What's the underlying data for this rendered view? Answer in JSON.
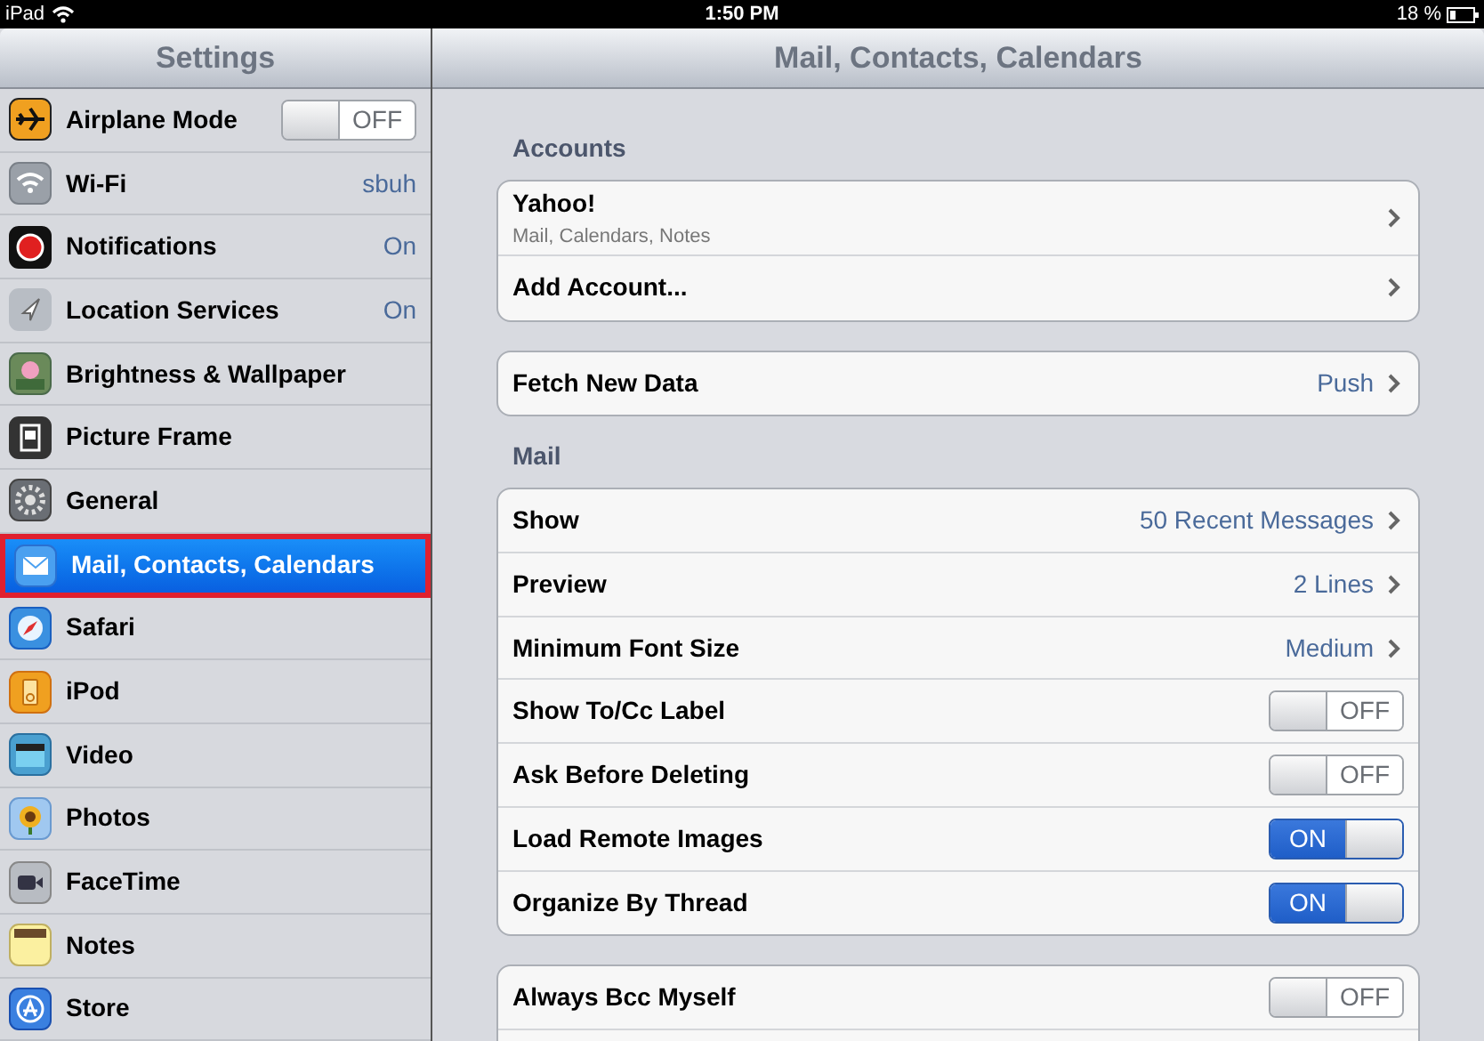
{
  "status_bar": {
    "device": "iPad",
    "time": "1:50 PM",
    "battery": "18 %"
  },
  "sidebar": {
    "title": "Settings",
    "items": [
      {
        "label": "Airplane Mode",
        "kind": "switch",
        "on": false,
        "switch_text": "OFF",
        "selected": false
      },
      {
        "label": "Wi-Fi",
        "kind": "link",
        "value": "sbuh",
        "selected": false
      },
      {
        "label": "Notifications",
        "kind": "link",
        "value": "On",
        "selected": false
      },
      {
        "label": "Location Services",
        "kind": "link",
        "value": "On",
        "selected": false
      },
      {
        "label": "Brightness & Wallpaper",
        "kind": "link",
        "selected": false
      },
      {
        "label": "Picture Frame",
        "kind": "link",
        "selected": false
      },
      {
        "label": "General",
        "kind": "link",
        "selected": false
      },
      {
        "label": "Mail, Contacts, Calendars",
        "kind": "link",
        "selected": true
      },
      {
        "label": "Safari",
        "kind": "link",
        "selected": false
      },
      {
        "label": "iPod",
        "kind": "link",
        "selected": false
      },
      {
        "label": "Video",
        "kind": "link",
        "selected": false
      },
      {
        "label": "Photos",
        "kind": "link",
        "selected": false
      },
      {
        "label": "FaceTime",
        "kind": "link",
        "selected": false
      },
      {
        "label": "Notes",
        "kind": "link",
        "selected": false
      },
      {
        "label": "Store",
        "kind": "link",
        "selected": false
      }
    ]
  },
  "detail": {
    "title": "Mail, Contacts, Calendars",
    "groups": [
      {
        "header": "Accounts",
        "rows": [
          {
            "label": "Yahoo!",
            "kind": "link",
            "subtitle": "Mail, Calendars, Notes"
          },
          {
            "label": "Add Account...",
            "kind": "link"
          }
        ]
      },
      {
        "rows": [
          {
            "label": "Fetch New Data",
            "kind": "link",
            "value": "Push"
          }
        ]
      },
      {
        "header": "Mail",
        "rows": [
          {
            "label": "Show",
            "kind": "link",
            "value": "50 Recent Messages"
          },
          {
            "label": "Preview",
            "kind": "link",
            "value": "2 Lines"
          },
          {
            "label": "Minimum Font Size",
            "kind": "link",
            "value": "Medium"
          },
          {
            "label": "Show To/Cc Label",
            "kind": "switch",
            "on": false,
            "switch_text": "OFF"
          },
          {
            "label": "Ask Before Deleting",
            "kind": "switch",
            "on": false,
            "switch_text": "OFF"
          },
          {
            "label": "Load Remote Images",
            "kind": "switch",
            "on": true,
            "switch_text": "ON"
          },
          {
            "label": "Organize By Thread",
            "kind": "switch",
            "on": true,
            "switch_text": "ON"
          }
        ]
      },
      {
        "rows": [
          {
            "label": "Always Bcc Myself",
            "kind": "switch",
            "on": false,
            "switch_text": "OFF"
          },
          {
            "kind": "cut"
          }
        ]
      }
    ]
  }
}
